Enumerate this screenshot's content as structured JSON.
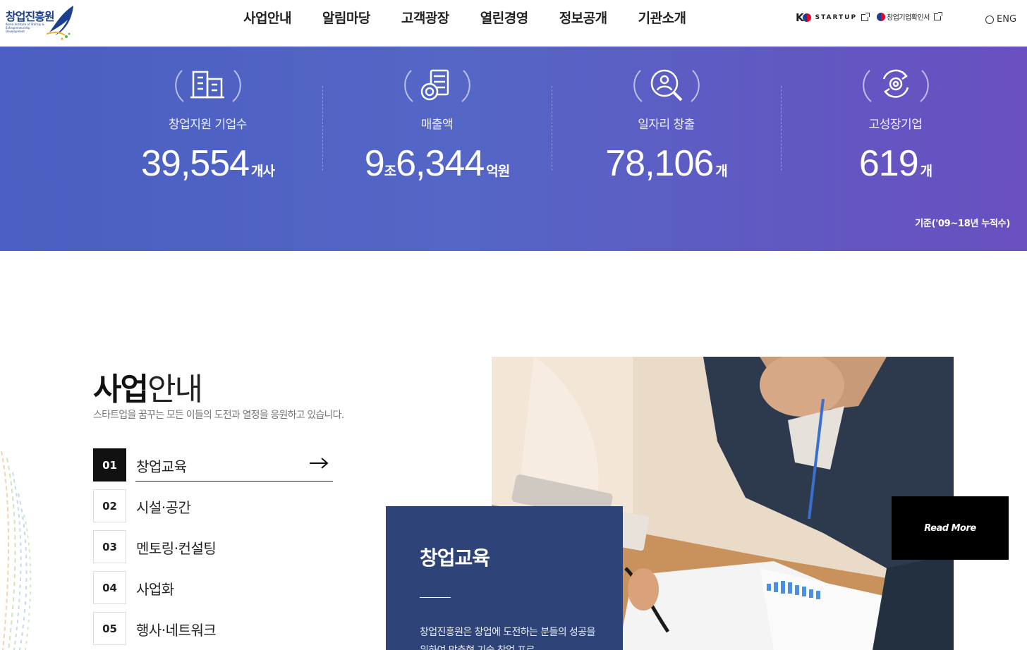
{
  "header": {
    "logo_text": "창업진흥원",
    "logo_sub": "Korea Institute of Startup & Entrepreneurship Development",
    "nav": [
      "사업안내",
      "알림마당",
      "고객광장",
      "열린경영",
      "정보공개",
      "기관소개"
    ],
    "kstartup": {
      "k": "K",
      "text": "STARTUP"
    },
    "cert_label": "창업기업확인서",
    "lang_label": "ENG"
  },
  "stats": {
    "items": [
      {
        "label": "창업지원 기업수",
        "value": "39,554",
        "unit": "개사",
        "icon": "building-icon"
      },
      {
        "label": "매출액",
        "value_a": "9",
        "mid": "조",
        "value_b": "6,344",
        "unit": "억원",
        "icon": "coins-icon"
      },
      {
        "label": "일자리 창출",
        "value": "78,106",
        "unit": "개",
        "icon": "person-search-icon"
      },
      {
        "label": "고성장기업",
        "value": "619",
        "unit": "개",
        "icon": "target-growth-icon"
      }
    ],
    "basis": "기준('09~18년 누적수)"
  },
  "business": {
    "title_bold": "사업",
    "title_light": "안내",
    "subtitle": "스타트업을 꿈꾸는 모든 이들의 도전과 열정을 응원하고 있습니다.",
    "menu": [
      {
        "num": "01",
        "label": "창업교육"
      },
      {
        "num": "02",
        "label": "시설·공간"
      },
      {
        "num": "03",
        "label": "멘토링·컨설팅"
      },
      {
        "num": "04",
        "label": "사업화"
      },
      {
        "num": "05",
        "label": "행사·네트워크"
      }
    ],
    "active_index": 0,
    "card": {
      "title": "창업교육",
      "desc": "창업진흥원은 창업에 도전하는 분들의 성공을 위하여 맞춤형 기술 창업 프로"
    },
    "read_more": "Read More"
  },
  "colors": {
    "brand": "#1b3f8f",
    "stats_gradient_start": "#4a5fc1",
    "stats_gradient_end": "#6a4fc0",
    "card_bg": "#2e4478"
  }
}
